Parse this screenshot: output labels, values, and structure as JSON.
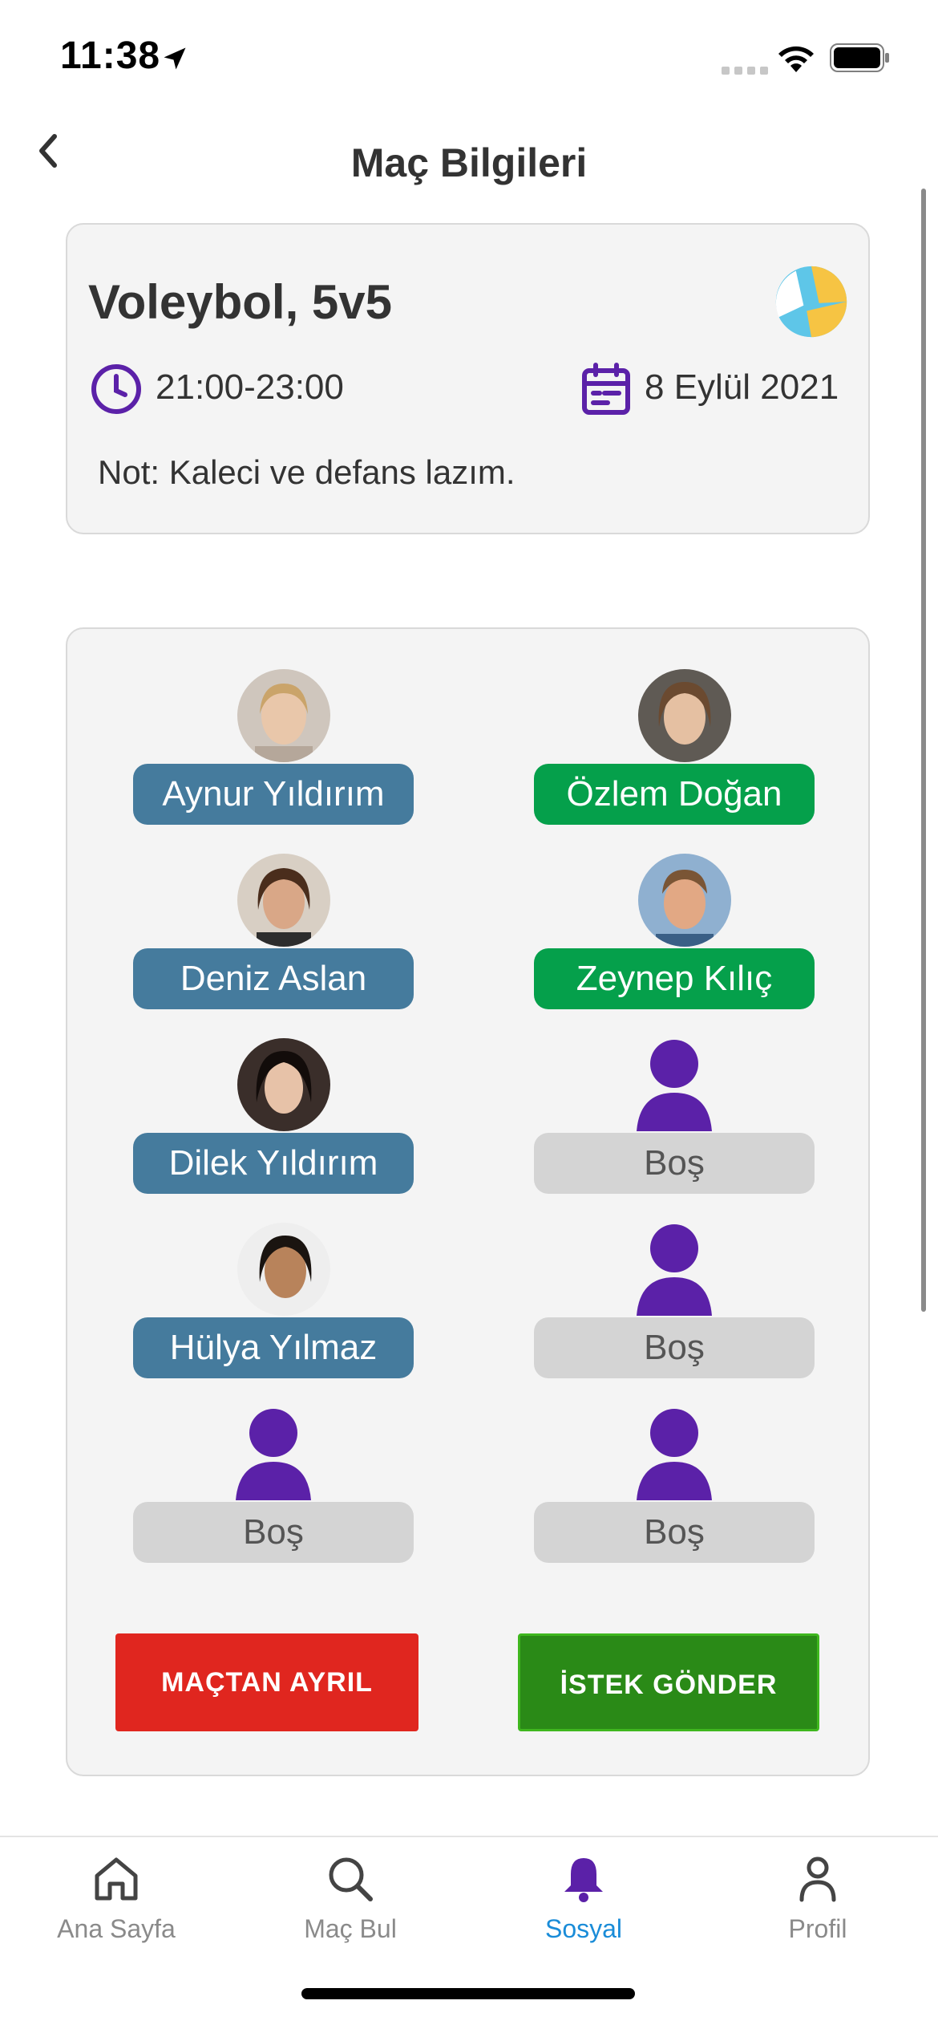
{
  "status_bar": {
    "time": "11:38"
  },
  "header": {
    "title": "Maç Bilgileri",
    "back_icon": "chevron-left-icon"
  },
  "match": {
    "sport_title": "Voleybol, 5v5",
    "time_range": "21:00-23:00",
    "date": "8 Eylül 2021",
    "note": "Not: Kaleci ve defans lazım.",
    "sport_icon": "volleyball-icon",
    "accent_color": "#5b21a8"
  },
  "team_left": [
    {
      "name": "Aynur Yıldırım",
      "status": "filled"
    },
    {
      "name": "Deniz Aslan",
      "status": "filled"
    },
    {
      "name": "Dilek Yıldırım",
      "status": "filled"
    },
    {
      "name": "Hülya Yılmaz",
      "status": "filled"
    },
    {
      "name": "Boş",
      "status": "empty"
    }
  ],
  "team_right": [
    {
      "name": "Özlem Doğan",
      "status": "filled"
    },
    {
      "name": "Zeynep Kılıç",
      "status": "filled"
    },
    {
      "name": "Boş",
      "status": "empty"
    },
    {
      "name": "Boş",
      "status": "empty"
    },
    {
      "name": "Boş",
      "status": "empty"
    }
  ],
  "colors": {
    "left_team": "#457b9d",
    "right_team": "#05a04b",
    "empty": "#d4d4d4",
    "leave": "#e0261f",
    "request": "#2a8a17"
  },
  "actions": {
    "leave_label": "MAÇTAN AYRIL",
    "request_label": "İSTEK GÖNDER"
  },
  "tabbar": {
    "tabs": [
      {
        "label": "Ana Sayfa",
        "icon": "home-icon"
      },
      {
        "label": "Maç Bul",
        "icon": "search-icon"
      },
      {
        "label": "Sosyal",
        "icon": "bell-icon",
        "active": true
      },
      {
        "label": "Profil",
        "icon": "profile-icon"
      }
    ]
  }
}
